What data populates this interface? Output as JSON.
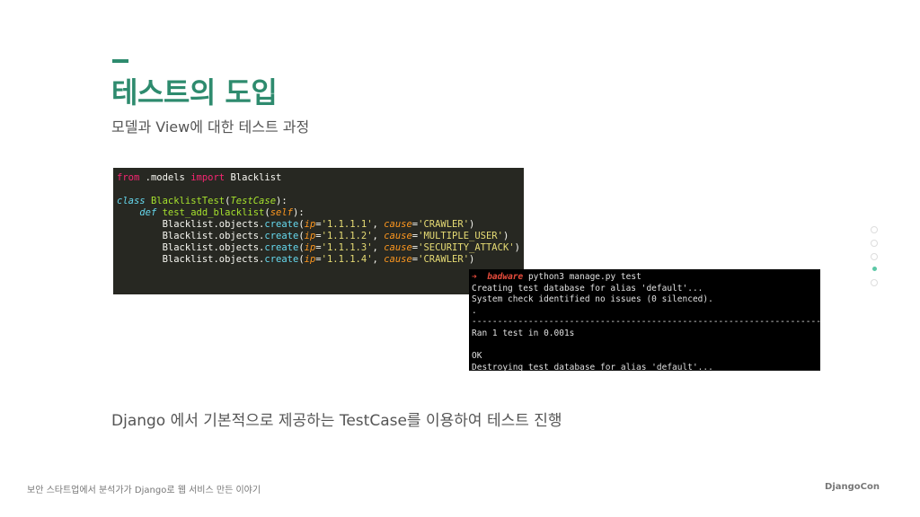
{
  "slide": {
    "title": "테스트의 도입",
    "subtitle": "모델과 View에 대한 테스트 과정",
    "body": "Django 에서 기본적으로 제공하는 TestCase를 이용하여 테스트 진행",
    "accent_color": "#2e8b6e"
  },
  "code": {
    "line1_kw1": "from",
    "line1_mid": " .models ",
    "line1_kw2": "import",
    "line1_end": " Blacklist",
    "class_kw": "class",
    "class_name": "BlacklistTest",
    "class_base": "TestCase",
    "def_kw": "def",
    "method_name": "test_add_blacklist",
    "self_arg": "self",
    "calls": [
      {
        "obj": "Blacklist.objects.",
        "fn": "create",
        "ip": "'1.1.1.1'",
        "cause": "'CRAWLER'"
      },
      {
        "obj": "Blacklist.objects.",
        "fn": "create",
        "ip": "'1.1.1.2'",
        "cause": "'MULTIPLE_USER'"
      },
      {
        "obj": "Blacklist.objects.",
        "fn": "create",
        "ip": "'1.1.1.3'",
        "cause": "'SECURITY_ATTACK'"
      },
      {
        "obj": "Blacklist.objects.",
        "fn": "create",
        "ip": "'1.1.1.4'",
        "cause": "'CRAWLER'"
      }
    ]
  },
  "terminal": {
    "prompt_arrow": "➜",
    "prompt_host": "badware",
    "command": " python3 manage.py test",
    "lines": [
      "Creating test database for alias 'default'...",
      "System check identified no issues (0 silenced).",
      ".",
      "----------------------------------------------------------------------",
      "Ran 1 test in 0.001s",
      "",
      "OK",
      "Destroying test database for alias 'default'..."
    ]
  },
  "footer": {
    "left": "보안 스타트업에서 분석가가 Django로 웹 서비스 만든 이야기",
    "right": "DjangoCon"
  },
  "pagination": {
    "count": 5,
    "active_index": 3
  }
}
